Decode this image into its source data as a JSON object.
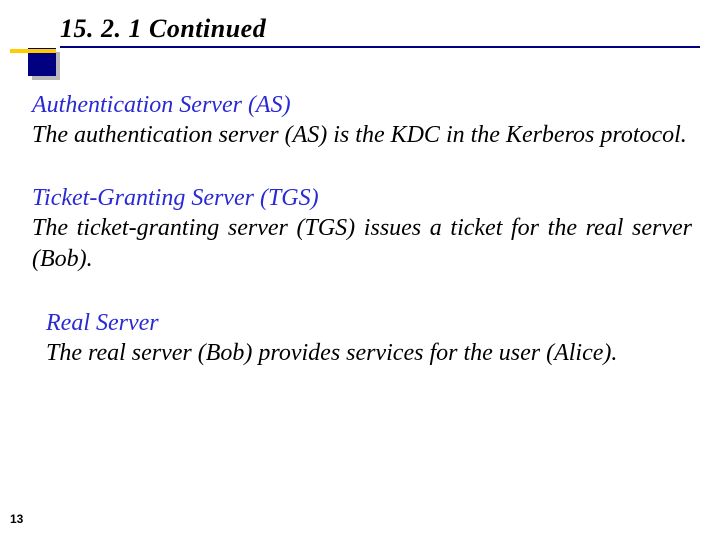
{
  "slide": {
    "title": "15. 2. 1  Continued",
    "page_number": "13"
  },
  "sections": [
    {
      "heading": "Authentication Server (AS)",
      "body": "The authentication server (AS) is the KDC in the Kerberos protocol."
    },
    {
      "heading": "Ticket-Granting Server (TGS)",
      "body": "The ticket-granting server (TGS) issues a ticket for the real server (Bob)."
    },
    {
      "heading": "Real Server",
      "body": "The real server (Bob) provides services for the user (Alice)."
    }
  ],
  "colors": {
    "title_underline": "#000080",
    "bullet_fill": "#000080",
    "accent_bar": "#ffcc00",
    "heading_text": "#2a2ad4"
  }
}
